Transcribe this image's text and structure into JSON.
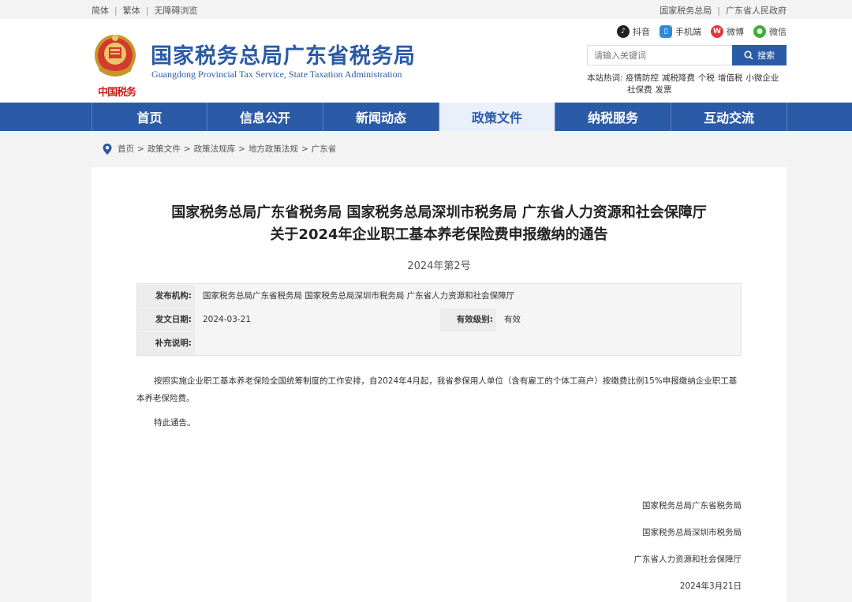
{
  "topbar": {
    "simplified": "简体",
    "traditional": "繁体",
    "accessible": "无障碍浏览",
    "link_sat": "国家税务总局",
    "link_gov": "广东省人民政府"
  },
  "header": {
    "title": "国家税务总局广东省税务局",
    "subtitle": "Guangdong Provincial Tax Service, State Taxation Administration",
    "emblem_text": "中国税务",
    "social": {
      "douyin": "抖音",
      "mobile": "手机端",
      "weibo": "微博",
      "wechat": "微信"
    },
    "search": {
      "placeholder": "请输入关键词",
      "button": "搜索"
    },
    "hot": {
      "label": "本站热词:",
      "tags": [
        "疫情防控",
        "减税降费",
        "个税",
        "增值税",
        "小微企业",
        "社保费",
        "发票"
      ]
    }
  },
  "nav": {
    "items": [
      "首页",
      "信息公开",
      "新闻动态",
      "政策文件",
      "纳税服务",
      "互动交流"
    ],
    "active": "政策文件"
  },
  "breadcrumb": [
    "首页",
    "政策文件",
    "政策法规库",
    "地方政策法规",
    "广东省"
  ],
  "article": {
    "title_line1": "国家税务总局广东省税务局 国家税务总局深圳市税务局 广东省人力资源和社会保障厅",
    "title_line2": "关于2024年企业职工基本养老保险费申报缴纳的通告",
    "doc_no": "2024年第2号",
    "meta": {
      "issuer_label": "发布机构:",
      "issuer": "国家税务总局广东省税务局 国家税务总局深圳市税务局 广东省人力资源和社会保障厅",
      "date_label": "发文日期:",
      "date": "2024-03-21",
      "validity_label": "有效级别:",
      "validity": "有效",
      "note_label": "补充说明:",
      "note": ""
    },
    "body": "按照实施企业职工基本养老保险全国统筹制度的工作安排，自2024年4月起，我省参保用人单位（含有雇工的个体工商户）按缴费比例15%申报缴纳企业职工基本养老保险费。",
    "closing": "特此通告。",
    "signatures": [
      "国家税务总局广东省税务局",
      "国家税务总局深圳市税务局",
      "广东省人力资源和社会保障厅"
    ],
    "sign_date": "2024年3月21日"
  },
  "colors": {
    "brand_blue": "#2b5aa6",
    "nav_active_bg": "#eaf0f9"
  }
}
